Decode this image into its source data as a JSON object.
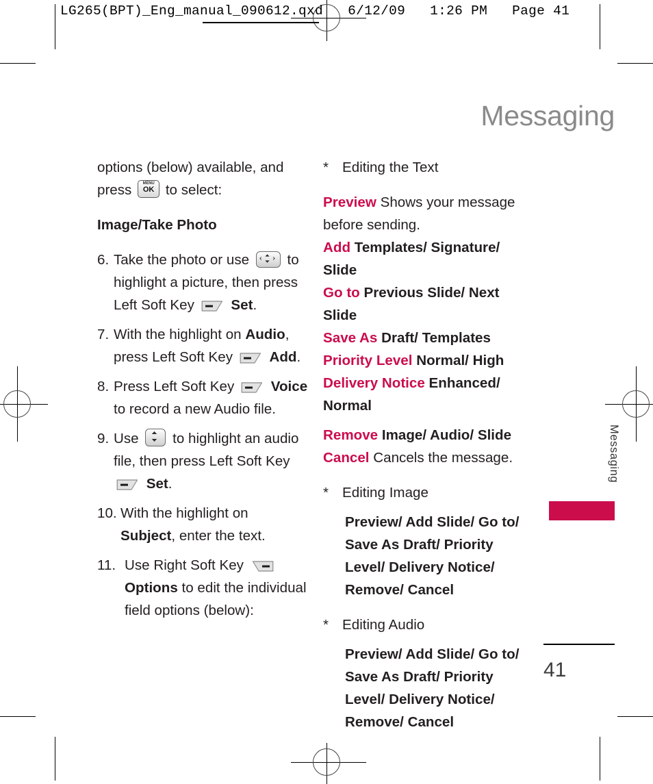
{
  "slug": {
    "text": "LG265(BPT)_Eng_manual_090612.qxd   6/12/09   1:26 PM   Page 41"
  },
  "page_title": "Messaging",
  "side_tab": {
    "label": "Messaging",
    "color": "#cb0d4c"
  },
  "footer": {
    "page_number": "41"
  },
  "accent_color": "#cb0d4c",
  "left_column": {
    "intro": {
      "line1": "options (below) available, and",
      "line2_pre": "press",
      "key": "menu-ok-key",
      "line2_post": "to select:"
    },
    "heading": "Image/Take Photo",
    "steps": [
      {
        "number": "6.",
        "parts": {
          "a": "Take the photo or use",
          "key1": "four-way-nav-key",
          "b": "to highlight a picture, then press Left Soft Key",
          "key2": "left-soft-key",
          "bold": "Set",
          "tail": "."
        }
      },
      {
        "number": "7.",
        "parts": {
          "a": "With the highlight on",
          "bold1": "Audio",
          "b": ", press Left Soft Key",
          "key1": "left-soft-key",
          "bold2": "Add",
          "tail": "."
        }
      },
      {
        "number": "8.",
        "parts": {
          "a": "Press Left Soft Key",
          "key1": "left-soft-key",
          "bold1": "Voice",
          "b": "to record a new Audio file."
        }
      },
      {
        "number": "9.",
        "parts": {
          "a": "Use",
          "key1": "up-down-nav-key",
          "b": "to highlight an audio file, then press Left Soft Key",
          "key2": "left-soft-key",
          "bold1": "Set",
          "tail": "."
        }
      },
      {
        "number": "10.",
        "parts": {
          "a": "With the highlight on",
          "bold1": "Subject",
          "b": ", enter the text."
        }
      },
      {
        "number": "11.",
        "parts": {
          "a": "Use Right Soft Key",
          "key1": "right-soft-key",
          "bold1": "Options",
          "b": "to edit the individual field options (below):"
        }
      }
    ]
  },
  "right_column": {
    "section_text": {
      "star": "*",
      "title": "Editing the Text",
      "options": [
        {
          "key": "Preview",
          "value": "Shows your message before sending.",
          "value_bold": false
        },
        {
          "key": "Add",
          "value": "Templates/ Signature/ Slide",
          "value_bold": true
        },
        {
          "key": "Go to",
          "value": "Previous Slide/ Next Slide",
          "value_bold": true
        },
        {
          "key": "Save As",
          "value": "Draft/ Templates",
          "value_bold": true
        },
        {
          "key": "Priority Level",
          "value": "Normal/ High",
          "value_bold": true
        },
        {
          "key": "Delivery Notice",
          "value": "Enhanced/ Normal",
          "value_bold": true
        },
        {
          "key": "Remove",
          "value": "Image/ Audio/ Slide",
          "value_bold": true
        },
        {
          "key": "Cancel",
          "value": "Cancels the message.",
          "value_bold": false
        }
      ]
    },
    "section_image": {
      "star": "*",
      "title": "Editing Image",
      "body": "Preview/ Add Slide/ Go to/ Save As Draft/ Priority Level/ Delivery Notice/ Remove/ Cancel"
    },
    "section_audio": {
      "star": "*",
      "title": "Editing Audio",
      "body": "Preview/ Add Slide/ Go to/ Save As Draft/ Priority Level/ Delivery Notice/ Remove/ Cancel"
    }
  },
  "keys": {
    "menu_ok": {
      "top": "MENU",
      "bottom": "OK"
    }
  }
}
